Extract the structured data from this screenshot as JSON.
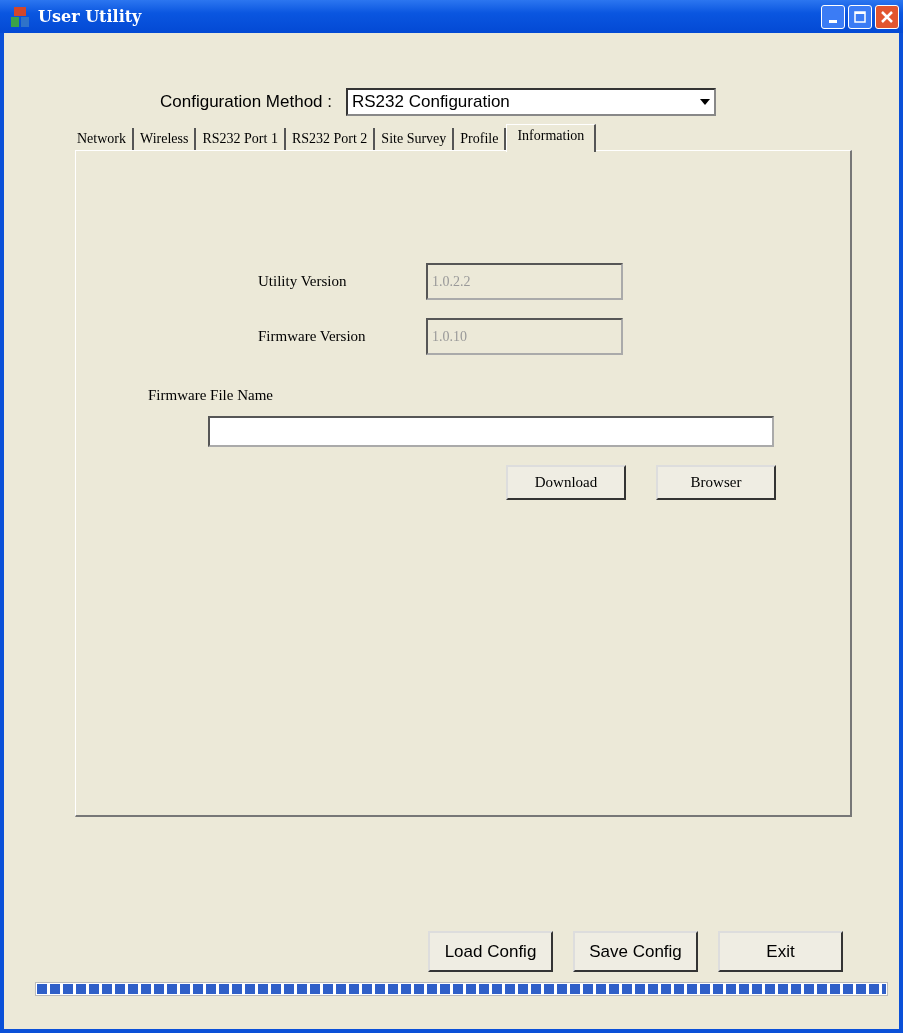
{
  "window": {
    "title": "User Utility"
  },
  "config_method": {
    "label": "Configuration Method :",
    "value": "RS232 Configuration"
  },
  "tabs": [
    {
      "label": "Network",
      "selected": false
    },
    {
      "label": "Wireless",
      "selected": false
    },
    {
      "label": "RS232 Port 1",
      "selected": false
    },
    {
      "label": "RS232 Port 2",
      "selected": false
    },
    {
      "label": "Site Survey",
      "selected": false
    },
    {
      "label": "Profile",
      "selected": false
    },
    {
      "label": "Information",
      "selected": true
    }
  ],
  "information": {
    "fields": [
      {
        "label": "Utility Version",
        "value": "1.0.2.2",
        "disabled": true
      },
      {
        "label": "Firmware Version",
        "value": "1.0.10",
        "disabled": true
      }
    ],
    "file_label": "Firmware File Name",
    "buttons": [
      "Download",
      "Browser"
    ]
  },
  "buttons": [
    "Load Config",
    "Save Config",
    "Exit"
  ],
  "progress": {
    "level": 1
  }
}
